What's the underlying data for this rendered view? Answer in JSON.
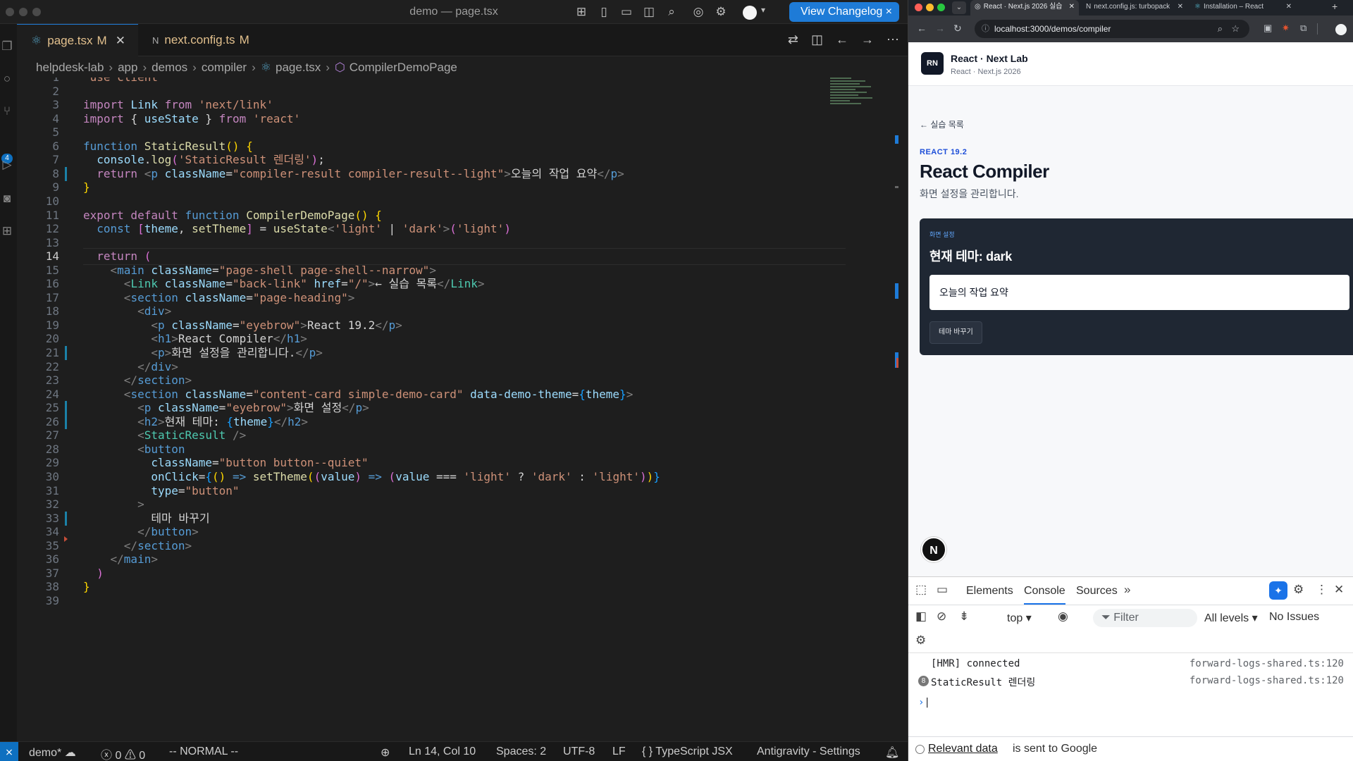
{
  "vscode": {
    "title": "demo — page.tsx",
    "changelog_button": "View Changelog",
    "tabs": [
      {
        "label": "page.tsx",
        "modified": "M",
        "icon": "react-icon"
      },
      {
        "label": "next.config.ts",
        "modified": "M",
        "icon": "N"
      }
    ],
    "breadcrumb": [
      "helpdesk-lab",
      "app",
      "demos",
      "compiler",
      "page.tsx",
      "CompilerDemoPage"
    ],
    "current_line": 14,
    "line_count": 39,
    "status": {
      "branch": "demo*",
      "problems_errors": "0",
      "problems_warnings": "0",
      "vim_mode": "-- NORMAL --",
      "cursor": "Ln 14, Col 10",
      "indent": "Spaces: 2",
      "encoding": "UTF-8",
      "eol": "LF",
      "language": "TypeScript JSX",
      "extension": "Antigravity - Settings"
    },
    "activity_badge": "4"
  },
  "chrome": {
    "tabs": [
      {
        "title": "React · Next.js 2026 실습",
        "active": true
      },
      {
        "title": "next.config.js: turbopack",
        "active": false
      },
      {
        "title": "Installation – React",
        "active": false
      }
    ],
    "url": "localhost:3000/demos/compiler",
    "site": {
      "logo": "RN",
      "title": "React · Next Lab",
      "subtitle": "React · Next.js 2026",
      "back_link": "← 실습 목록",
      "eyebrow": "REACT 19.2",
      "heading": "React Compiler",
      "description": "화면 설정을 관리합니다.",
      "card_eyebrow": "화면 설정",
      "card_heading": "현재 테마: dark",
      "card_result": "오늘의 작업 요약",
      "card_button": "테마 바꾸기",
      "next_badge": "N"
    },
    "devtools": {
      "tabs": [
        "Elements",
        "Console",
        "Sources"
      ],
      "active_tab": "Console",
      "context": "top ▾",
      "filter_placeholder": "Filter",
      "levels": "All levels ▾",
      "issues": "No Issues",
      "messages": [
        {
          "text": "[HMR] connected",
          "source": "forward-logs-shared.ts:120",
          "count": ""
        },
        {
          "text": "StaticResult 렌더링",
          "source": "forward-logs-shared.ts:120",
          "count": "8"
        }
      ],
      "prompt": "›",
      "footer_link": "Relevant data",
      "footer_text": "is sent to Google"
    }
  },
  "code_lines": [
    [
      {
        "c": "str",
        "t": "'use client'"
      }
    ],
    [],
    [
      {
        "c": "kw2",
        "t": "import "
      },
      {
        "c": "var",
        "t": "Link "
      },
      {
        "c": "kw2",
        "t": "from "
      },
      {
        "c": "str",
        "t": "'next/link'"
      }
    ],
    [
      {
        "c": "kw2",
        "t": "import "
      },
      {
        "c": "pun",
        "t": "{ "
      },
      {
        "c": "var",
        "t": "useState "
      },
      {
        "c": "pun",
        "t": "} "
      },
      {
        "c": "kw2",
        "t": "from "
      },
      {
        "c": "str",
        "t": "'react'"
      }
    ],
    [],
    [
      {
        "c": "kw",
        "t": "function "
      },
      {
        "c": "fn",
        "t": "StaticResult"
      },
      {
        "c": "br1",
        "t": "() "
      },
      {
        "c": "br1",
        "t": "{"
      }
    ],
    [
      {
        "c": "txt",
        "t": "  "
      },
      {
        "c": "var",
        "t": "console"
      },
      {
        "c": "pun",
        "t": "."
      },
      {
        "c": "fn",
        "t": "log"
      },
      {
        "c": "br2",
        "t": "("
      },
      {
        "c": "str",
        "t": "'StaticResult 렌더링'"
      },
      {
        "c": "br2",
        "t": ")"
      },
      {
        "c": "pun",
        "t": ";"
      }
    ],
    [
      {
        "c": "txt",
        "t": "  "
      },
      {
        "c": "kw2",
        "t": "return "
      },
      {
        "c": "br",
        "t": "<"
      },
      {
        "c": "tag",
        "t": "p "
      },
      {
        "c": "attr",
        "t": "className"
      },
      {
        "c": "pun",
        "t": "="
      },
      {
        "c": "str",
        "t": "\"compiler-result compiler-result--light\""
      },
      {
        "c": "br",
        "t": ">"
      },
      {
        "c": "txt",
        "t": "오늘의 작업 요약"
      },
      {
        "c": "br",
        "t": "</"
      },
      {
        "c": "tag",
        "t": "p"
      },
      {
        "c": "br",
        "t": ">"
      }
    ],
    [
      {
        "c": "br1",
        "t": "}"
      }
    ],
    [],
    [
      {
        "c": "kw2",
        "t": "export default "
      },
      {
        "c": "kw",
        "t": "function "
      },
      {
        "c": "fn",
        "t": "CompilerDemoPage"
      },
      {
        "c": "br1",
        "t": "() "
      },
      {
        "c": "br1",
        "t": "{"
      }
    ],
    [
      {
        "c": "txt",
        "t": "  "
      },
      {
        "c": "kw",
        "t": "const "
      },
      {
        "c": "br2",
        "t": "["
      },
      {
        "c": "var",
        "t": "theme"
      },
      {
        "c": "pun",
        "t": ", "
      },
      {
        "c": "fn",
        "t": "setTheme"
      },
      {
        "c": "br2",
        "t": "]"
      },
      {
        "c": "pun",
        "t": " = "
      },
      {
        "c": "fn",
        "t": "useState"
      },
      {
        "c": "br",
        "t": "<"
      },
      {
        "c": "str",
        "t": "'light'"
      },
      {
        "c": "pun",
        "t": " | "
      },
      {
        "c": "str",
        "t": "'dark'"
      },
      {
        "c": "br",
        "t": ">"
      },
      {
        "c": "br2",
        "t": "("
      },
      {
        "c": "str",
        "t": "'light'"
      },
      {
        "c": "br2",
        "t": ")"
      }
    ],
    [],
    [
      {
        "c": "txt",
        "t": "  "
      },
      {
        "c": "kw2",
        "t": "return "
      },
      {
        "c": "br2",
        "t": "("
      }
    ],
    [
      {
        "c": "txt",
        "t": "    "
      },
      {
        "c": "br",
        "t": "<"
      },
      {
        "c": "tag",
        "t": "main "
      },
      {
        "c": "attr",
        "t": "className"
      },
      {
        "c": "pun",
        "t": "="
      },
      {
        "c": "str",
        "t": "\"page-shell page-shell--narrow\""
      },
      {
        "c": "br",
        "t": ">"
      }
    ],
    [
      {
        "c": "txt",
        "t": "      "
      },
      {
        "c": "br",
        "t": "<"
      },
      {
        "c": "typ",
        "t": "Link "
      },
      {
        "c": "attr",
        "t": "className"
      },
      {
        "c": "pun",
        "t": "="
      },
      {
        "c": "str",
        "t": "\"back-link\" "
      },
      {
        "c": "attr",
        "t": "href"
      },
      {
        "c": "pun",
        "t": "="
      },
      {
        "c": "str",
        "t": "\"/\""
      },
      {
        "c": "br",
        "t": ">"
      },
      {
        "c": "txt",
        "t": "← 실습 목록"
      },
      {
        "c": "br",
        "t": "</"
      },
      {
        "c": "typ",
        "t": "Link"
      },
      {
        "c": "br",
        "t": ">"
      }
    ],
    [
      {
        "c": "txt",
        "t": "      "
      },
      {
        "c": "br",
        "t": "<"
      },
      {
        "c": "tag",
        "t": "section "
      },
      {
        "c": "attr",
        "t": "className"
      },
      {
        "c": "pun",
        "t": "="
      },
      {
        "c": "str",
        "t": "\"page-heading\""
      },
      {
        "c": "br",
        "t": ">"
      }
    ],
    [
      {
        "c": "txt",
        "t": "        "
      },
      {
        "c": "br",
        "t": "<"
      },
      {
        "c": "tag",
        "t": "div"
      },
      {
        "c": "br",
        "t": ">"
      }
    ],
    [
      {
        "c": "txt",
        "t": "          "
      },
      {
        "c": "br",
        "t": "<"
      },
      {
        "c": "tag",
        "t": "p "
      },
      {
        "c": "attr",
        "t": "className"
      },
      {
        "c": "pun",
        "t": "="
      },
      {
        "c": "str",
        "t": "\"eyebrow\""
      },
      {
        "c": "br",
        "t": ">"
      },
      {
        "c": "txt",
        "t": "React 19.2"
      },
      {
        "c": "br",
        "t": "</"
      },
      {
        "c": "tag",
        "t": "p"
      },
      {
        "c": "br",
        "t": ">"
      }
    ],
    [
      {
        "c": "txt",
        "t": "          "
      },
      {
        "c": "br",
        "t": "<"
      },
      {
        "c": "tag",
        "t": "h1"
      },
      {
        "c": "br",
        "t": ">"
      },
      {
        "c": "txt",
        "t": "React Compiler"
      },
      {
        "c": "br",
        "t": "</"
      },
      {
        "c": "tag",
        "t": "h1"
      },
      {
        "c": "br",
        "t": ">"
      }
    ],
    [
      {
        "c": "txt",
        "t": "          "
      },
      {
        "c": "br",
        "t": "<"
      },
      {
        "c": "tag",
        "t": "p"
      },
      {
        "c": "br",
        "t": ">"
      },
      {
        "c": "txt",
        "t": "화면 설정을 관리합니다."
      },
      {
        "c": "br",
        "t": "</"
      },
      {
        "c": "tag",
        "t": "p"
      },
      {
        "c": "br",
        "t": ">"
      }
    ],
    [
      {
        "c": "txt",
        "t": "        "
      },
      {
        "c": "br",
        "t": "</"
      },
      {
        "c": "tag",
        "t": "div"
      },
      {
        "c": "br",
        "t": ">"
      }
    ],
    [
      {
        "c": "txt",
        "t": "      "
      },
      {
        "c": "br",
        "t": "</"
      },
      {
        "c": "tag",
        "t": "section"
      },
      {
        "c": "br",
        "t": ">"
      }
    ],
    [
      {
        "c": "txt",
        "t": "      "
      },
      {
        "c": "br",
        "t": "<"
      },
      {
        "c": "tag",
        "t": "section "
      },
      {
        "c": "attr",
        "t": "className"
      },
      {
        "c": "pun",
        "t": "="
      },
      {
        "c": "str",
        "t": "\"content-card simple-demo-card\" "
      },
      {
        "c": "attr",
        "t": "data-demo-theme"
      },
      {
        "c": "pun",
        "t": "="
      },
      {
        "c": "br3",
        "t": "{"
      },
      {
        "c": "var",
        "t": "theme"
      },
      {
        "c": "br3",
        "t": "}"
      },
      {
        "c": "br",
        "t": ">"
      }
    ],
    [
      {
        "c": "txt",
        "t": "        "
      },
      {
        "c": "br",
        "t": "<"
      },
      {
        "c": "tag",
        "t": "p "
      },
      {
        "c": "attr",
        "t": "className"
      },
      {
        "c": "pun",
        "t": "="
      },
      {
        "c": "str",
        "t": "\"eyebrow\""
      },
      {
        "c": "br",
        "t": ">"
      },
      {
        "c": "txt",
        "t": "화면 설정"
      },
      {
        "c": "br",
        "t": "</"
      },
      {
        "c": "tag",
        "t": "p"
      },
      {
        "c": "br",
        "t": ">"
      }
    ],
    [
      {
        "c": "txt",
        "t": "        "
      },
      {
        "c": "br",
        "t": "<"
      },
      {
        "c": "tag",
        "t": "h2"
      },
      {
        "c": "br",
        "t": ">"
      },
      {
        "c": "txt",
        "t": "현재 테마: "
      },
      {
        "c": "br3",
        "t": "{"
      },
      {
        "c": "var",
        "t": "theme"
      },
      {
        "c": "br3",
        "t": "}"
      },
      {
        "c": "br",
        "t": "</"
      },
      {
        "c": "tag",
        "t": "h2"
      },
      {
        "c": "br",
        "t": ">"
      }
    ],
    [
      {
        "c": "txt",
        "t": "        "
      },
      {
        "c": "br",
        "t": "<"
      },
      {
        "c": "typ",
        "t": "StaticResult "
      },
      {
        "c": "br",
        "t": "/>"
      }
    ],
    [
      {
        "c": "txt",
        "t": "        "
      },
      {
        "c": "br",
        "t": "<"
      },
      {
        "c": "tag",
        "t": "button"
      }
    ],
    [
      {
        "c": "txt",
        "t": "          "
      },
      {
        "c": "attr",
        "t": "className"
      },
      {
        "c": "pun",
        "t": "="
      },
      {
        "c": "str",
        "t": "\"button button--quiet\""
      }
    ],
    [
      {
        "c": "txt",
        "t": "          "
      },
      {
        "c": "attr",
        "t": "onClick"
      },
      {
        "c": "pun",
        "t": "="
      },
      {
        "c": "br3",
        "t": "{"
      },
      {
        "c": "br1",
        "t": "() "
      },
      {
        "c": "kw",
        "t": "=> "
      },
      {
        "c": "fn",
        "t": "setTheme"
      },
      {
        "c": "br1",
        "t": "("
      },
      {
        "c": "br2",
        "t": "("
      },
      {
        "c": "var",
        "t": "value"
      },
      {
        "c": "br2",
        "t": ") "
      },
      {
        "c": "kw",
        "t": "=> "
      },
      {
        "c": "br2",
        "t": "("
      },
      {
        "c": "var",
        "t": "value "
      },
      {
        "c": "pun",
        "t": "=== "
      },
      {
        "c": "str",
        "t": "'light' "
      },
      {
        "c": "pun",
        "t": "? "
      },
      {
        "c": "str",
        "t": "'dark' "
      },
      {
        "c": "pun",
        "t": ": "
      },
      {
        "c": "str",
        "t": "'light'"
      },
      {
        "c": "br2",
        "t": ")"
      },
      {
        "c": "br1",
        "t": ")"
      },
      {
        "c": "br3",
        "t": "}"
      }
    ],
    [
      {
        "c": "txt",
        "t": "          "
      },
      {
        "c": "attr",
        "t": "type"
      },
      {
        "c": "pun",
        "t": "="
      },
      {
        "c": "str",
        "t": "\"button\""
      }
    ],
    [
      {
        "c": "txt",
        "t": "        "
      },
      {
        "c": "br",
        "t": ">"
      }
    ],
    [
      {
        "c": "txt",
        "t": "          테마 바꾸기"
      }
    ],
    [
      {
        "c": "txt",
        "t": "        "
      },
      {
        "c": "br",
        "t": "</"
      },
      {
        "c": "tag",
        "t": "button"
      },
      {
        "c": "br",
        "t": ">"
      }
    ],
    [
      {
        "c": "txt",
        "t": "      "
      },
      {
        "c": "br",
        "t": "</"
      },
      {
        "c": "tag",
        "t": "section"
      },
      {
        "c": "br",
        "t": ">"
      }
    ],
    [
      {
        "c": "txt",
        "t": "    "
      },
      {
        "c": "br",
        "t": "</"
      },
      {
        "c": "tag",
        "t": "main"
      },
      {
        "c": "br",
        "t": ">"
      }
    ],
    [
      {
        "c": "txt",
        "t": "  "
      },
      {
        "c": "br2",
        "t": ")"
      }
    ],
    [
      {
        "c": "br1",
        "t": "}"
      }
    ],
    []
  ],
  "gutter_marked_lines": [
    8,
    21,
    25,
    26,
    33
  ],
  "gutter_deleted_lines": [
    35
  ]
}
